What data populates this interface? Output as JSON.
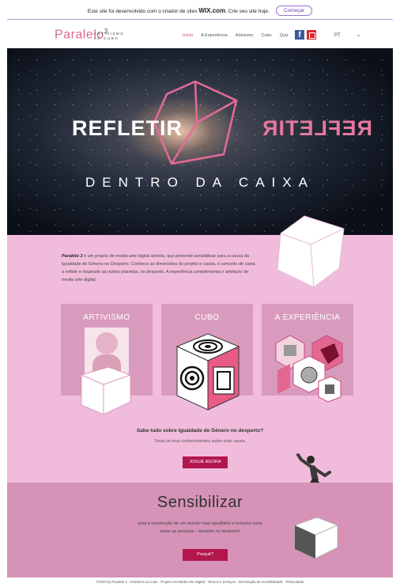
{
  "wix_banner": {
    "text_prefix": "Este site foi desenvolvido com o criador de sites",
    "brand": "WIX.com",
    "text_suffix": ". Crie seu site hoje.",
    "button": "Começar"
  },
  "header": {
    "logo": "Paralelo",
    "logo_sup": "3",
    "logo_sub_line1": "ARTIVISMO",
    "logo_sub_line2": "AO CUBO",
    "nav": [
      "Início",
      "A Experiência",
      "Artivismo",
      "Cubo",
      "Quiz"
    ],
    "lang": "PT"
  },
  "hero": {
    "word_left": "REFLETIR",
    "word_right": "REFLETIR",
    "subtitle": "DENTRO DA CAIXA"
  },
  "intro": {
    "title": "Paralelo 3",
    "body": "é um projeto de media arte digital ativista, que pretende sensibilizar para a causa da Igualdade de Género no Desporto. Conhece as dimensões do projeto e causa, o conceito de caixa a refletir e inspirado as outras planetas, no desporto. A experiência complementa o artefacto de media arte digital."
  },
  "cards": [
    {
      "title": "ARTIVISMO"
    },
    {
      "title": "CUBO"
    },
    {
      "title": "A EXPERIÊNCIA"
    }
  ],
  "cta": {
    "question": "Sabe tudo sobre Igualdade de Género no desporto?",
    "sub": "Testa os teus conhecimentos sobre esta causa.",
    "button": "JOGUE AGORA"
  },
  "sens": {
    "title": "Sensibilizar",
    "text": "para a construção de um mundo mais igualitário e inclusivo para todas as pessoas – também no desporto!",
    "button": "Porquê?"
  },
  "footer": "©2023 by Paralelo 3 - Artivismo ao Cubo · Projeto em Media Arte Digital · Termos e Serviços · Declaração de Acessibilidade · Privacidade"
}
